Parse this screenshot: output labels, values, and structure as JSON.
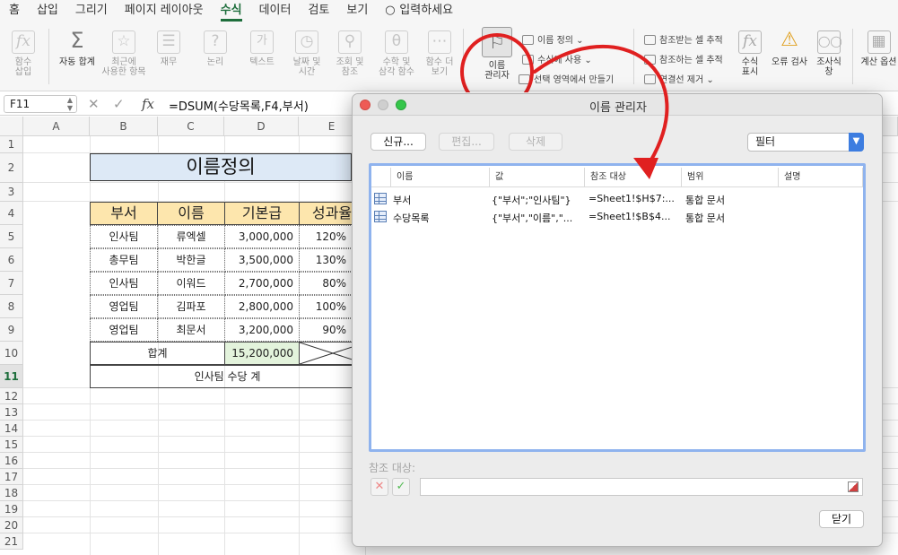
{
  "menu": {
    "tabs": [
      "홈",
      "삽입",
      "그리기",
      "페이지 레이아웃",
      "수식",
      "데이터",
      "검토",
      "보기"
    ],
    "active_tab": "수식",
    "tell_me": "입력하세요"
  },
  "ribbon": {
    "insert_function": "함수\n삽입",
    "autosum": "자동 합계",
    "recent": "최근에\n사용한 항목",
    "financial": "재무",
    "logical": "논리",
    "text": "텍스트",
    "date_time": "날짜 및\n시간",
    "lookup": "조회 및\n참조",
    "math": "수학 및\n삼각 함수",
    "more": "함수 더\n보기",
    "name_manager": "이름\n관리자",
    "define_name": "이름 정의",
    "use_in_formula": "수식에 사용",
    "create_from_selection": "선택 영역에서 만들기",
    "trace_precedents": "참조받는 셀 추적",
    "trace_dependents": "참조하는 셀 추적",
    "remove_arrows": "연결선 제거",
    "show_formulas": "수식\n표시",
    "error_checking": "오류 검사",
    "watch": "조사식\n창",
    "calc_options": "계산 옵션"
  },
  "formula_bar": {
    "name_box": "F11",
    "fx": "fx",
    "formula": "=DSUM(수당목록,F4,부서)"
  },
  "sheet": {
    "columns": [
      "A",
      "B",
      "C",
      "D",
      "E"
    ],
    "rows": [
      "1",
      "2",
      "3",
      "4",
      "5",
      "6",
      "7",
      "8",
      "9",
      "10",
      "11",
      "12",
      "13",
      "14",
      "15",
      "16",
      "17",
      "18",
      "19",
      "20",
      "21"
    ],
    "title": "이름정의",
    "headers": [
      "부서",
      "이름",
      "기본급",
      "성과율"
    ],
    "data": [
      [
        "인사팀",
        "류엑셀",
        "3,000,000",
        "120%"
      ],
      [
        "총무팀",
        "박한글",
        "3,500,000",
        "130%"
      ],
      [
        "인사팀",
        "이워드",
        "2,700,000",
        "80%"
      ],
      [
        "영업팀",
        "김파포",
        "2,800,000",
        "100%"
      ],
      [
        "영업팀",
        "최문서",
        "3,200,000",
        "90%"
      ]
    ],
    "total_label": "합계",
    "total_value": "15,200,000",
    "summary_label": "인사팀 수당 계"
  },
  "dialog": {
    "title": "이름 관리자",
    "buttons": {
      "new": "신규...",
      "edit": "편집...",
      "delete": "삭제",
      "close": "닫기"
    },
    "filter": "필터",
    "columns": [
      "이름",
      "값",
      "참조 대상",
      "범위",
      "설명"
    ],
    "rows": [
      {
        "name": "부서",
        "value": "{\"부서\";\"인사팀\"}",
        "refers_to": "=Sheet1!$H$7:...",
        "scope": "통합 문서",
        "comment": ""
      },
      {
        "name": "수당목록",
        "value": "{\"부서\",\"이름\",\"...",
        "refers_to": "=Sheet1!$B$4...",
        "scope": "통합 문서",
        "comment": ""
      }
    ],
    "refers_to_label": "참조 대상:"
  },
  "colors": {
    "accent_green": "#1e6e3c",
    "title_fill": "#dde9f6",
    "header_fill": "#fde6ad",
    "total_fill": "#e3f3dc",
    "annotation_red": "#e02020",
    "list_focus": "#8fb3ee"
  }
}
